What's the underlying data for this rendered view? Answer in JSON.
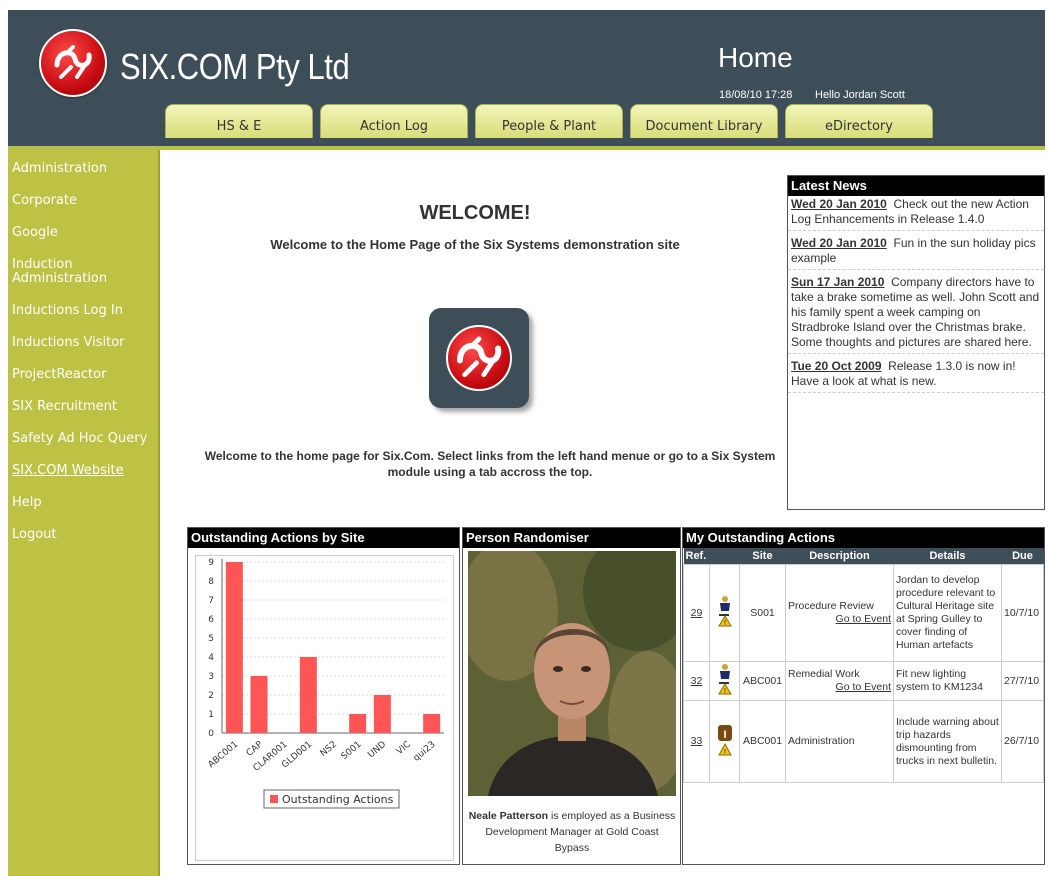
{
  "header": {
    "company": "SIX.COM Pty Ltd",
    "page_title": "Home",
    "timestamp": "18/08/10 17:28",
    "greeting": "Hello Jordan Scott",
    "tabs": [
      "HS & E",
      "Action Log",
      "People & Plant",
      "Document Library",
      "eDirectory"
    ]
  },
  "sidebar": {
    "items": [
      {
        "label": "Administration"
      },
      {
        "label": "Corporate"
      },
      {
        "label": "Google"
      },
      {
        "label": "Induction Administration"
      },
      {
        "label": "Inductions Log In"
      },
      {
        "label": "Inductions Visitor"
      },
      {
        "label": "ProjectReactor"
      },
      {
        "label": "SIX Recruitment"
      },
      {
        "label": "Safety Ad Hoc Query"
      },
      {
        "label": "SIX.COM Website"
      },
      {
        "label": "Help"
      },
      {
        "label": "Logout"
      }
    ]
  },
  "welcome": {
    "title": "WELCOME!",
    "subtitle": "Welcome to the Home Page of the Six Systems demonstration site",
    "body": "Welcome to the home page for Six.Com. Select links from the left hand menue or go to a Six System module using a tab accross the top."
  },
  "news": {
    "title": "Latest News",
    "items": [
      {
        "date": "Wed 20 Jan 2010",
        "text": "Check out the new Action Log Enhancements in Release 1.4.0"
      },
      {
        "date": "Wed 20 Jan 2010",
        "text": "Fun in the sun holiday pics example"
      },
      {
        "date": "Sun 17 Jan 2010",
        "text": "Company directors have to take a brake sometime as well. John Scott and his family spent a week camping on Stradbroke Island over the Christmas brake. Some thoughts and pictures are shared here."
      },
      {
        "date": "Tue 20 Oct 2009",
        "text": "Release 1.3.0 is now in! Have a look at what is new."
      }
    ]
  },
  "chart_panel": {
    "title": "Outstanding Actions by Site"
  },
  "chart_data": {
    "type": "bar",
    "categories": [
      "ABC001",
      "CAP",
      "CLAR001",
      "GLD001",
      "NS2",
      "S001",
      "UND",
      "VIC",
      "qui23"
    ],
    "series": [
      {
        "name": "Outstanding Actions",
        "values": [
          9,
          3,
          0,
          4,
          0,
          1,
          2,
          0,
          1
        ],
        "color": "#ff5555"
      }
    ],
    "yticks": [
      "0",
      "1",
      "2",
      "3",
      "4",
      "5",
      "6",
      "7",
      "8",
      "9"
    ],
    "ylim": [
      0,
      9
    ],
    "grid": true,
    "legend": "bottom"
  },
  "person": {
    "title": "Person Randomiser",
    "name": "Neale Patterson",
    "desc": " is employed as a Business Development Manager at Gold Coast Bypass"
  },
  "actions": {
    "title": "My Outstanding Actions",
    "columns": [
      "Ref.",
      "",
      "Site",
      "Description",
      "Details",
      "Due"
    ],
    "rows": [
      {
        "ref": "29",
        "site": "S001",
        "desc": "Procedure Review",
        "link": "Go to Event",
        "details": "Jordan to develop procedure relevant to Cultural Heritage site at Spring Gulley to cover finding of Human artefacts",
        "due": "10/7/10",
        "icon": "person-warning-icon"
      },
      {
        "ref": "32",
        "site": "ABC001",
        "desc": "Remedial Work",
        "link": "Go to Event",
        "details": "Fit new lighting system to KM1234",
        "due": "27/7/10",
        "icon": "person-warning-icon"
      },
      {
        "ref": "33",
        "site": "ABC001",
        "desc": "Administration",
        "link": "",
        "details": "Include warning about trip hazards dismounting from trucks in next bulletin.",
        "due": "26/7/10",
        "icon": "info-warning-icon"
      }
    ]
  }
}
